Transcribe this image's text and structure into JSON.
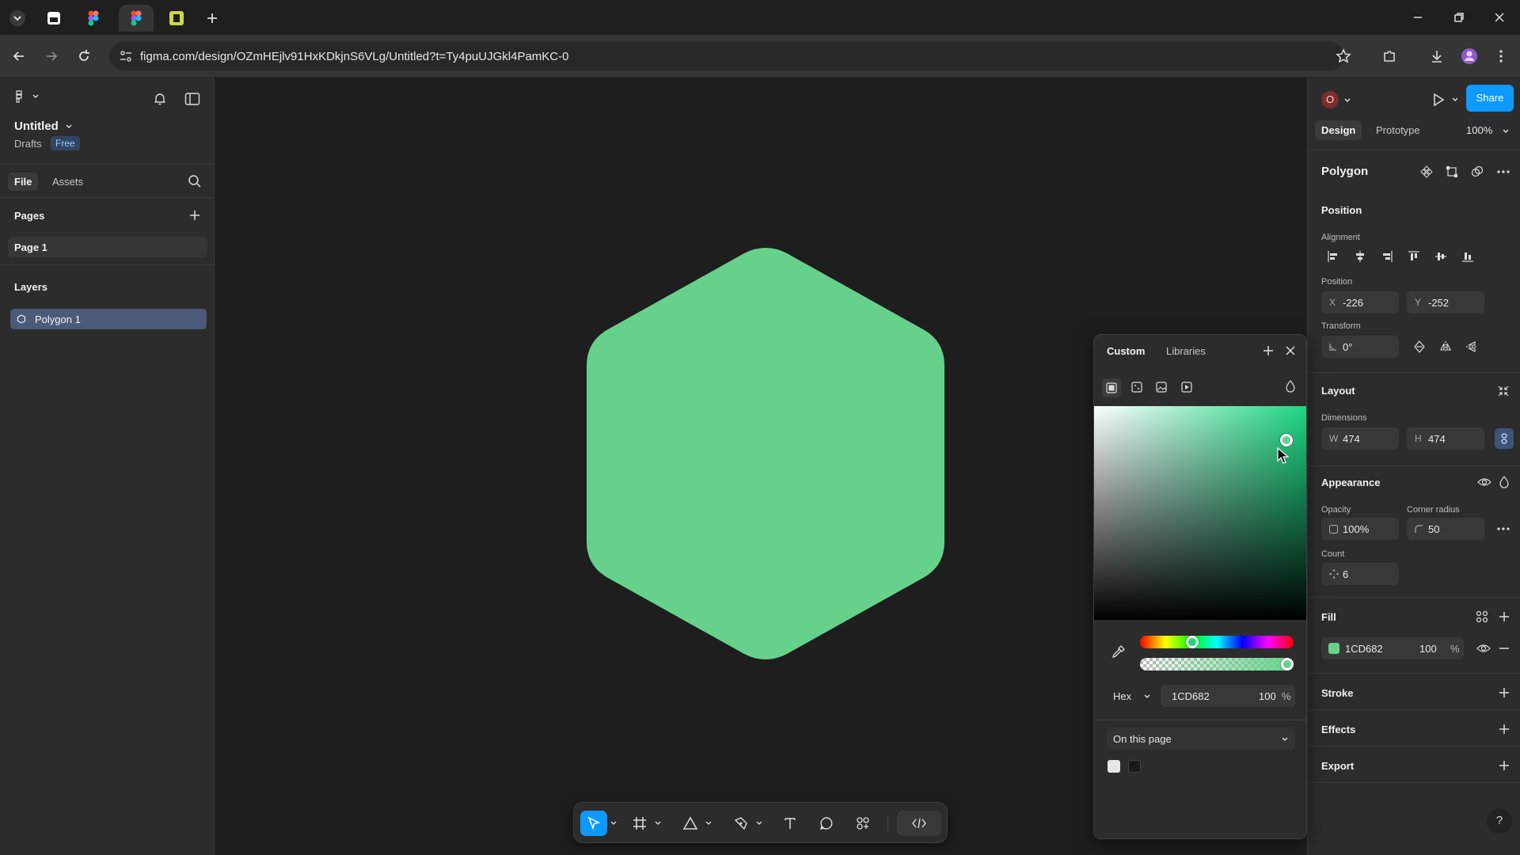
{
  "browser": {
    "url": "figma.com/design/OZmHEjlv91HxKDkjnS6VLg/Untitled?t=Ty4puUJGkl4PamKC-0"
  },
  "file": {
    "title": "Untitled",
    "location": "Drafts",
    "plan_badge": "Free",
    "tabs": [
      "File",
      "Assets"
    ]
  },
  "pages": {
    "heading": "Pages",
    "items": [
      "Page 1"
    ]
  },
  "layers": {
    "heading": "Layers",
    "items": [
      "Polygon 1"
    ]
  },
  "header": {
    "avatar_initial": "O",
    "share_label": "Share",
    "tabs": [
      "Design",
      "Prototype"
    ],
    "zoom": "100%"
  },
  "design": {
    "selection_name": "Polygon",
    "position_heading": "Position",
    "alignment_label": "Alignment",
    "position_label": "Position",
    "x_prefix": "X",
    "x_value": "-226",
    "y_prefix": "Y",
    "y_value": "-252",
    "transform_label": "Transform",
    "rotation": "0°",
    "layout_heading": "Layout",
    "dimensions_label": "Dimensions",
    "w_prefix": "W",
    "w_value": "474",
    "h_prefix": "H",
    "h_value": "474",
    "appearance_heading": "Appearance",
    "opacity_label": "Opacity",
    "opacity_value": "100%",
    "corner_radius_label": "Corner radius",
    "corner_radius_value": "50",
    "count_label": "Count",
    "count_value": "6",
    "fill_heading": "Fill",
    "fill_hex": "1CD682",
    "fill_opacity": "100",
    "fill_percent": "%",
    "stroke_heading": "Stroke",
    "effects_heading": "Effects",
    "export_heading": "Export"
  },
  "picker": {
    "tabs": [
      "Custom",
      "Libraries"
    ],
    "mode": "Hex",
    "hex_value": "1CD682",
    "opacity_value": "100",
    "percent": "%",
    "swatch_scope": "On this page",
    "hue_position": 0.34,
    "alpha_value": 1.0,
    "sv_saturation": 0.9,
    "sv_value": 0.84
  },
  "colors": {
    "fill": "#66d18b",
    "picker_hue": "#1cd682",
    "accent": "#0d99ff",
    "swatch_1": "#e6e6e6",
    "swatch_2": "#1a1a1a"
  },
  "help_label": "?"
}
